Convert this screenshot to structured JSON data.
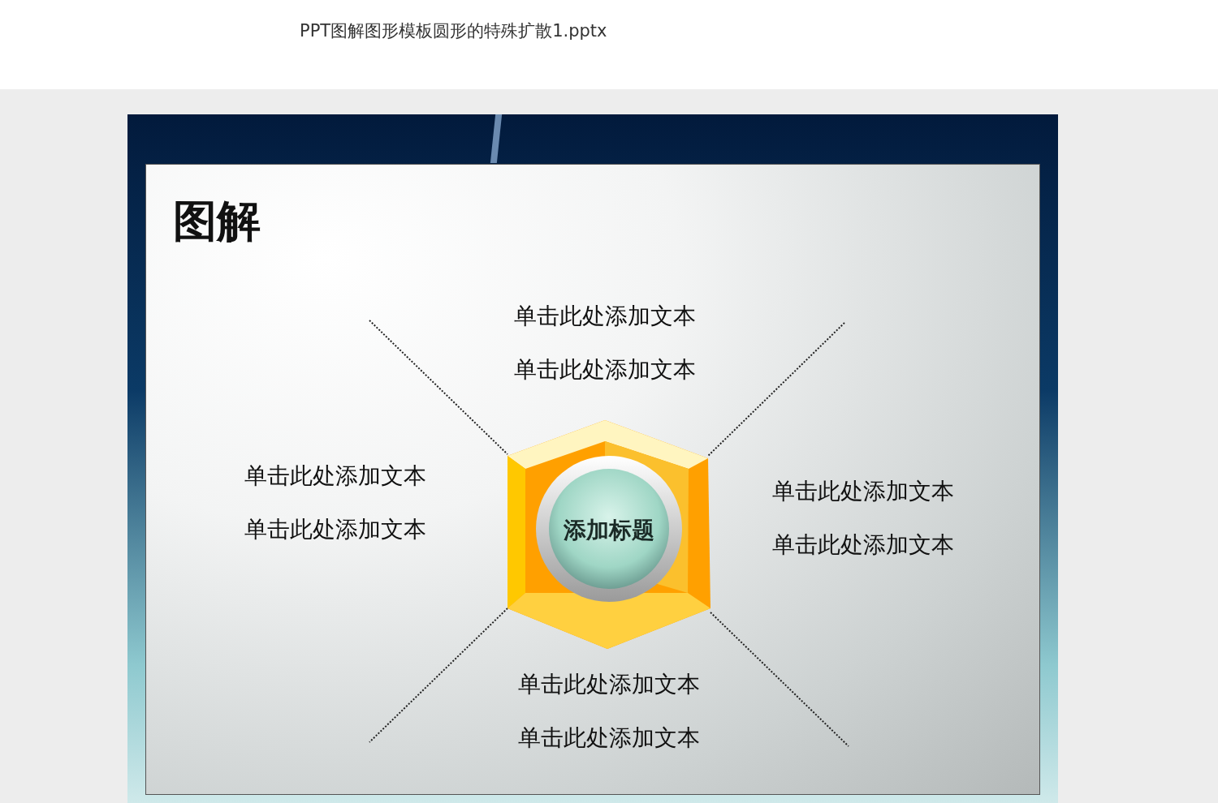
{
  "document": {
    "title": "PPT图解图形模板圆形的特殊扩散1.pptx"
  },
  "slide": {
    "title": "图解",
    "center_label": "添加标题",
    "text_groups": [
      {
        "kind": "top",
        "lines": [
          "单击此处添加文本",
          "单击此处添加文本"
        ]
      },
      {
        "kind": "left",
        "lines": [
          "单击此处添加文本",
          "单击此处添加文本"
        ]
      },
      {
        "kind": "right",
        "lines": [
          "单击此处添加文本",
          "单击此处添加文本"
        ]
      },
      {
        "kind": "bottom",
        "lines": [
          "单击此处添加文本",
          "单击此处添加文本"
        ]
      }
    ]
  }
}
